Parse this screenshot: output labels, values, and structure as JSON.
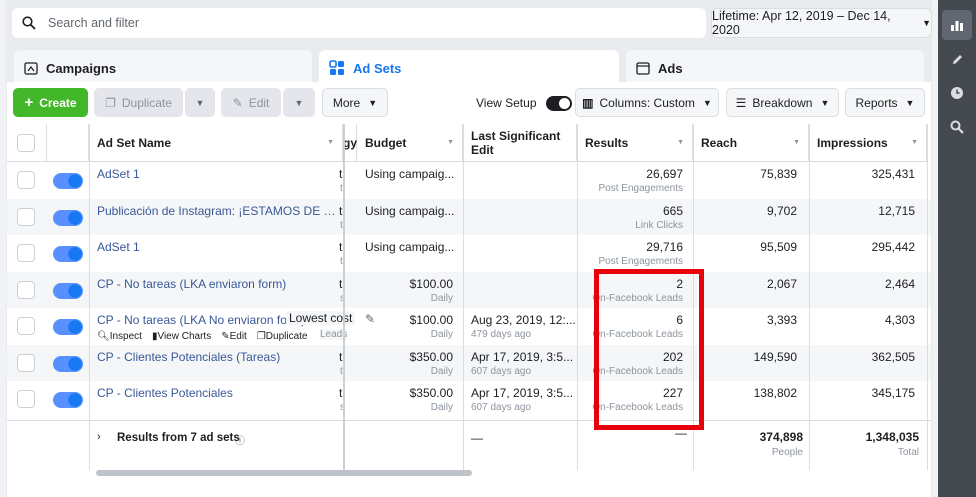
{
  "search": {
    "placeholder": "Search and filter"
  },
  "date_range": {
    "label": "Lifetime: Apr 12, 2019 – Dec 14, 2020"
  },
  "tabs": [
    {
      "label": "Campaigns"
    },
    {
      "label": "Ad Sets"
    },
    {
      "label": "Ads"
    }
  ],
  "toolbar": {
    "create_label": "Create",
    "duplicate_label": "Duplicate",
    "edit_label": "Edit",
    "more_label": "More",
    "view_setup_label": "View Setup",
    "columns_label": "Columns: Custom",
    "breakdown_label": "Breakdown",
    "reports_label": "Reports"
  },
  "table": {
    "headers": {
      "name": "Ad Set Name",
      "bid": "gy",
      "budget": "Budget",
      "last_edit": "Last Significant Edit",
      "results": "Results",
      "reach": "Reach",
      "impressions": "Impressions"
    },
    "rows": [
      {
        "name": "AdSet 1",
        "budget": "Using campaig...",
        "budget_sub": "",
        "last_edit": "",
        "last_edit_sub": "",
        "results": "26,697",
        "results_sub": "Post Engagements",
        "reach": "75,839",
        "impressions": "325,431"
      },
      {
        "name": "Publicación de Instagram: ¡ESTAMOS DE SOR...",
        "budget": "Using campaig...",
        "budget_sub": "",
        "last_edit": "",
        "last_edit_sub": "",
        "results": "665",
        "results_sub": "Link Clicks",
        "reach": "9,702",
        "impressions": "12,715"
      },
      {
        "name": "AdSet 1",
        "budget": "Using campaig...",
        "budget_sub": "",
        "last_edit": "",
        "last_edit_sub": "",
        "results": "29,716",
        "results_sub": "Post Engagements",
        "reach": "95,509",
        "impressions": "295,442"
      },
      {
        "name": "CP - No tareas (LKA enviaron form)",
        "budget": "$100.00",
        "budget_sub": "Daily",
        "last_edit": "",
        "last_edit_sub": "",
        "results": "2",
        "results_sub": "On-Facebook Leads",
        "reach": "2,067",
        "impressions": "2,464"
      },
      {
        "name": "CP - No tareas (LKA No enviaron form)",
        "budget": "$100.00",
        "budget_sub": "Daily",
        "last_edit": "Aug 23, 2019, 12:...",
        "last_edit_sub": "479 days ago",
        "results": "6",
        "results_sub": "On-Facebook Leads",
        "reach": "3,393",
        "impressions": "4,303"
      },
      {
        "name": "CP - Clientes Potenciales (Tareas)",
        "budget": "$350.00",
        "budget_sub": "Daily",
        "last_edit": "Apr 17, 2019, 3:5...",
        "last_edit_sub": "607 days ago",
        "results": "202",
        "results_sub": "On-Facebook Leads",
        "reach": "149,590",
        "impressions": "362,505"
      },
      {
        "name": "CP - Clientes Potenciales",
        "budget": "$350.00",
        "budget_sub": "Daily",
        "last_edit": "Apr 17, 2019, 3:5...",
        "last_edit_sub": "607 days ago",
        "results": "227",
        "results_sub": "On-Facebook Leads",
        "reach": "138,802",
        "impressions": "345,175"
      }
    ],
    "bid_fragments": [
      "t",
      "t",
      "t",
      "t",
      "t",
      "t",
      "t"
    ],
    "bid_subs": [
      "t",
      "t",
      "t",
      "s",
      "",
      "t",
      "s"
    ],
    "hover_tooltip": {
      "text": "Lowest cost",
      "sub": "Leads"
    },
    "row_actions": {
      "inspect": "Inspect",
      "view_charts": "View Charts",
      "edit": "Edit",
      "duplicate": "Duplicate"
    },
    "summary": {
      "label": "Results from 7 ad sets",
      "last_edit": "—",
      "results": "—",
      "reach": "374,898",
      "reach_sub": "People",
      "impressions": "1,348,035",
      "impressions_sub": "Total"
    }
  },
  "colors": {
    "accent": "#1877f2",
    "create": "#42b72a",
    "highlight": "#e8000b"
  }
}
